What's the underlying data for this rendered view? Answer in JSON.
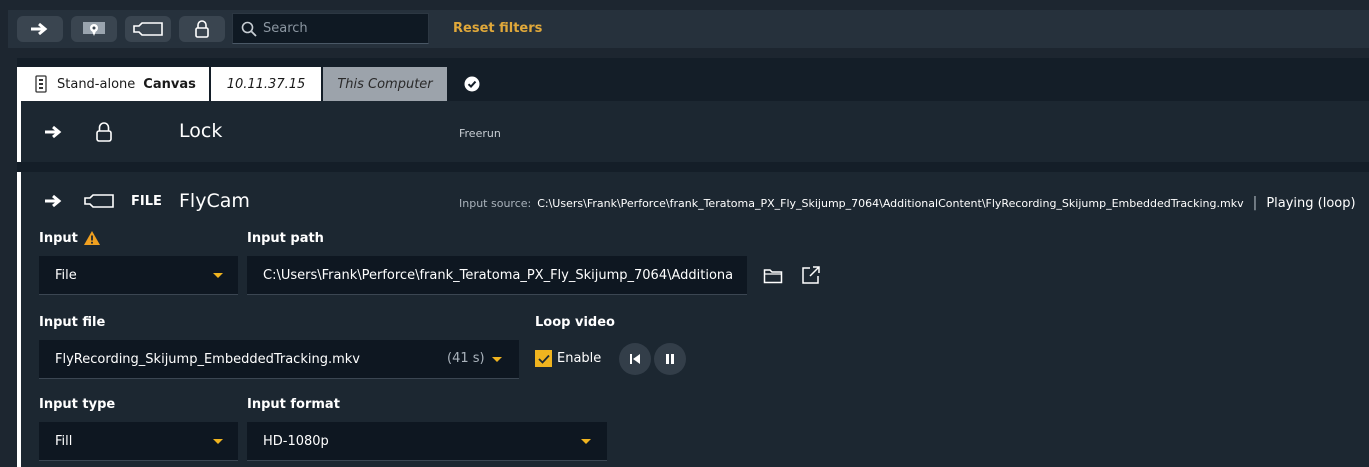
{
  "toolbar": {
    "search_placeholder": "Search",
    "reset_filters": "Reset filters"
  },
  "tabs": {
    "canvas_prefix": "Stand-alone",
    "canvas_name": "Canvas",
    "ip": "10.11.37.15",
    "computer": "This Computer"
  },
  "lock_row": {
    "title": "Lock",
    "status": "Freerun"
  },
  "file_section": {
    "type_badge": "FILE",
    "title": "FlyCam",
    "input_source_label": "Input source:",
    "input_source_path": "C:\\Users\\Frank\\Perforce\\frank_Teratoma_PX_Fly_Skijump_7064\\AdditionalContent\\FlyRecording_Skijump_EmbeddedTracking.mkv",
    "separator": "|",
    "playback_status": "Playing (loop)",
    "input_label": "Input",
    "input_value": "File",
    "input_path_label": "Input path",
    "input_path_value": "C:\\Users\\Frank\\Perforce\\frank_Teratoma_PX_Fly_Skijump_7064\\Additiona",
    "input_file_label": "Input file",
    "input_file_value": "FlyRecording_Skijump_EmbeddedTracking.mkv",
    "input_file_duration": "(41 s)",
    "loop_video_label": "Loop video",
    "loop_enable_label": "Enable",
    "input_type_label": "Input type",
    "input_type_value": "Fill",
    "input_format_label": "Input format",
    "input_format_value": "HD-1080p"
  },
  "colors": {
    "accent": "#f0b41f",
    "reset_filters": "#e0a83a",
    "warning": "#f0a020"
  },
  "icons": [
    "arrow-right-icon",
    "camera-location-icon",
    "camera-icon",
    "lock-icon",
    "search-icon",
    "canvas-icon",
    "check-circle-icon",
    "warning-icon",
    "folder-icon",
    "open-external-icon",
    "skip-back-icon",
    "pause-icon",
    "chevron-down-icon"
  ]
}
